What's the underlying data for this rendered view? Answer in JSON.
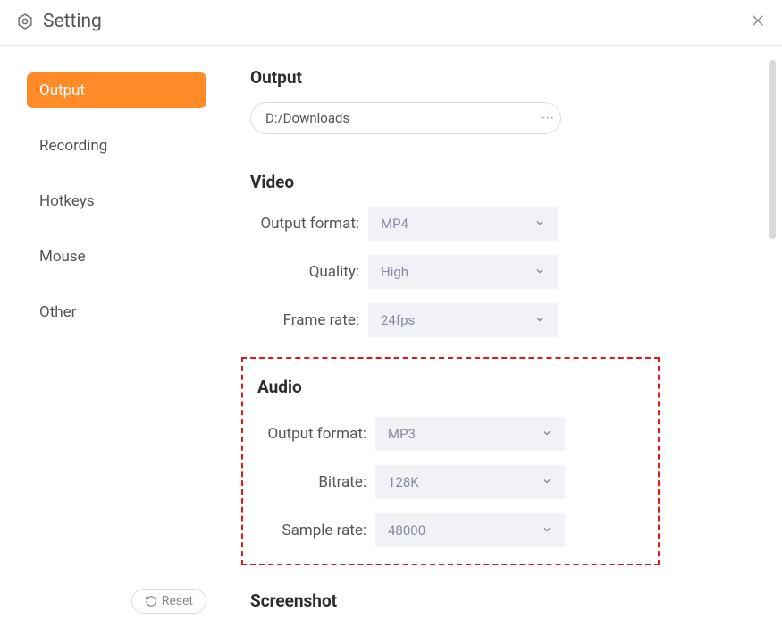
{
  "header": {
    "title": "Setting"
  },
  "sidebar": {
    "items": [
      {
        "label": "Output",
        "active": true
      },
      {
        "label": "Recording",
        "active": false
      },
      {
        "label": "Hotkeys",
        "active": false
      },
      {
        "label": "Mouse",
        "active": false
      },
      {
        "label": "Other",
        "active": false
      }
    ],
    "reset_label": "Reset"
  },
  "output": {
    "section_label": "Output",
    "path": "D:/Downloads",
    "more": "···"
  },
  "video": {
    "section_label": "Video",
    "output_format_label": "Output format:",
    "output_format_value": "MP4",
    "quality_label": "Quality:",
    "quality_value": "High",
    "frame_rate_label": "Frame rate:",
    "frame_rate_value": "24fps"
  },
  "audio": {
    "section_label": "Audio",
    "output_format_label": "Output format:",
    "output_format_value": "MP3",
    "bitrate_label": "Bitrate:",
    "bitrate_value": "128K",
    "sample_rate_label": "Sample rate:",
    "sample_rate_value": "48000"
  },
  "screenshot": {
    "section_label": "Screenshot"
  }
}
